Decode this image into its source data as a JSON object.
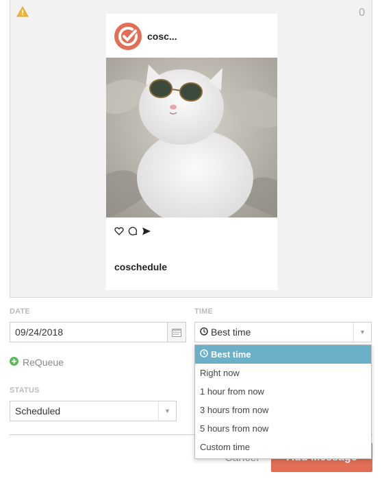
{
  "preview": {
    "char_count": "0",
    "account_name": "cosc...",
    "username": "coschedule",
    "icons": [
      "warning-icon",
      "coschedule-logo",
      "heart-icon",
      "comment-icon",
      "share-icon"
    ]
  },
  "date": {
    "label": "DATE",
    "value": "09/24/2018"
  },
  "time": {
    "label": "TIME",
    "selected": "Best time"
  },
  "time_options": [
    {
      "label": "Best time",
      "active": true
    },
    {
      "label": "Right now",
      "active": false
    },
    {
      "label": "1 hour from now",
      "active": false
    },
    {
      "label": "3 hours from now",
      "active": false
    },
    {
      "label": "5 hours from now",
      "active": false
    },
    {
      "label": "Custom time",
      "active": false
    }
  ],
  "requeue_label": "ReQueue",
  "status": {
    "label": "STATUS",
    "selected": "Scheduled"
  },
  "buttons": {
    "cancel": "Cancel",
    "add": "Add Message"
  },
  "colors": {
    "brand": "#e26e55",
    "highlight": "#6ab0c8",
    "requeue_green": "#5cb85c",
    "warning": "#e8b83c"
  }
}
